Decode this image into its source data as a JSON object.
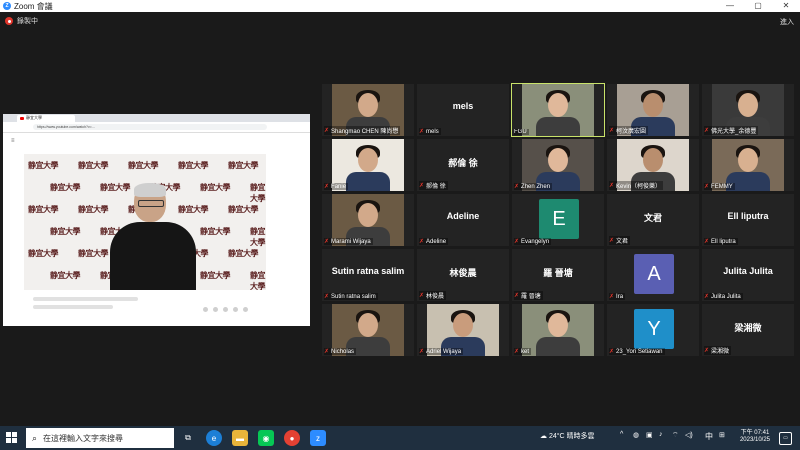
{
  "window": {
    "app_title": "Zoom 會議",
    "minimize": "—",
    "restore": "▢",
    "close": "✕"
  },
  "recording": {
    "label": "錄製中"
  },
  "top_right": {
    "enter_label": "進入"
  },
  "shared_screen": {
    "tab_title": "靜宜大學",
    "url": "https://www.youtube.com/watch?v=...",
    "watermark_text": "静宜大學"
  },
  "gallery": [
    {
      "name": "Shangmao CHEN 陳尚懋",
      "muted": true,
      "kind": "video"
    },
    {
      "name": "mels",
      "big": "mels",
      "muted": true,
      "kind": "name"
    },
    {
      "name": "FGU",
      "muted": false,
      "kind": "video",
      "active": true
    },
    {
      "name": "柯汶廣宏圓",
      "muted": true,
      "kind": "video"
    },
    {
      "name": "佛光大學_余德豐",
      "muted": true,
      "kind": "video"
    },
    {
      "name": "Fanie",
      "muted": true,
      "kind": "video"
    },
    {
      "name": "郝倫 徐",
      "big": "郝倫 徐",
      "muted": true,
      "kind": "name"
    },
    {
      "name": "Zhen Zhen",
      "muted": true,
      "kind": "video"
    },
    {
      "name": "Kevin（柯俊樂）",
      "muted": true,
      "kind": "video"
    },
    {
      "name": "FEMMY",
      "muted": true,
      "kind": "video"
    },
    {
      "name": "Marami Wijaya",
      "muted": true,
      "kind": "video"
    },
    {
      "name": "Adeline",
      "big": "Adeline",
      "muted": true,
      "kind": "name"
    },
    {
      "name": "Evangelyn",
      "letter": "E",
      "color": "#1e8a70",
      "muted": true,
      "kind": "avatar"
    },
    {
      "name": "文君",
      "big": "文君",
      "muted": true,
      "kind": "name"
    },
    {
      "name": "Ell liputra",
      "big": "Ell liputra",
      "muted": true,
      "kind": "name"
    },
    {
      "name": "Sutin ratna salim",
      "big": "Sutin ratna salim",
      "muted": true,
      "kind": "name"
    },
    {
      "name": "林俊晨",
      "big": "林俊晨",
      "muted": true,
      "kind": "name"
    },
    {
      "name": "羅 晉塘",
      "big": "羅 晉塘",
      "muted": true,
      "kind": "name"
    },
    {
      "name": "Ira",
      "letter": "A",
      "color": "#5a5fb3",
      "muted": true,
      "kind": "avatar"
    },
    {
      "name": "Julita Julita",
      "big": "Julita Julita",
      "muted": true,
      "kind": "name"
    },
    {
      "name": "Nicholas",
      "muted": true,
      "kind": "video"
    },
    {
      "name": "Adriel Wijaya",
      "muted": true,
      "kind": "video"
    },
    {
      "name": "ket",
      "muted": true,
      "kind": "video"
    },
    {
      "name": "23_Yori Setiawan",
      "letter": "Y",
      "color": "#1f8fc9",
      "muted": true,
      "kind": "avatar"
    },
    {
      "name": "梁湘微",
      "big": "梁湘微",
      "muted": true,
      "kind": "name"
    }
  ],
  "taskbar": {
    "search_placeholder": "在這裡輸入文字來搜尋",
    "weather": "24°C 晴時多雲",
    "ime": "中",
    "time": "下午 07:41",
    "date": "2023/10/25"
  }
}
